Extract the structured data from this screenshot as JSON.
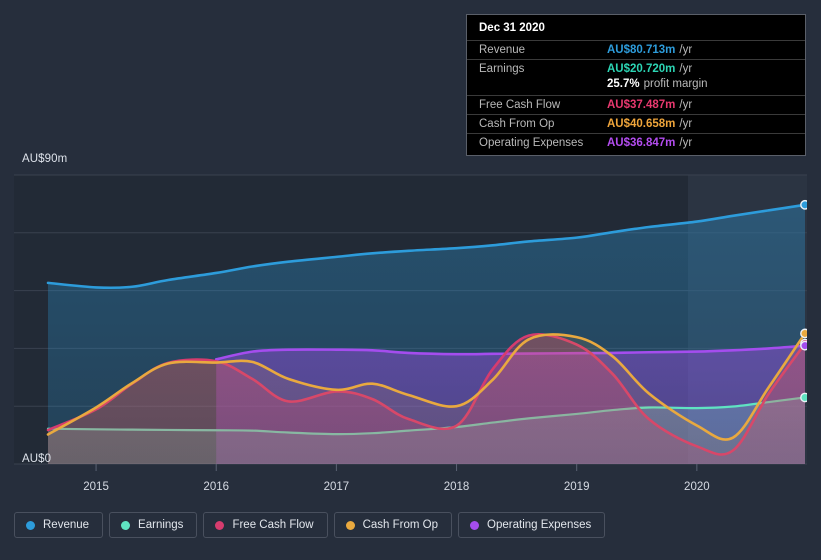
{
  "axis": {
    "y_max_label": "AU$90m",
    "y_min_label": "AU$0",
    "y_max_value": 90,
    "y_min_value": 0,
    "x_ticks": [
      "2015",
      "2016",
      "2017",
      "2018",
      "2019",
      "2020"
    ]
  },
  "tooltip": {
    "title": "Dec 31 2020",
    "rows": [
      {
        "label": "Revenue",
        "value": "AU$80.713m",
        "unit": "/yr",
        "color": "#2D9CDB"
      },
      {
        "label": "Earnings",
        "value": "AU$20.720m",
        "unit": "/yr",
        "color": "#2CD5B4"
      },
      {
        "label": "",
        "value": "25.7%",
        "unit": "profit margin",
        "color": "#FFFFFF"
      },
      {
        "label": "Free Cash Flow",
        "value": "AU$37.487m",
        "unit": "/yr",
        "color": "#E8396F"
      },
      {
        "label": "Cash From Op",
        "value": "AU$40.658m",
        "unit": "/yr",
        "color": "#EFA53B"
      },
      {
        "label": "Operating Expenses",
        "value": "AU$36.847m",
        "unit": "/yr",
        "color": "#B44DF0"
      }
    ]
  },
  "legend": {
    "items": [
      {
        "label": "Revenue",
        "color": "#2D9CDB"
      },
      {
        "label": "Earnings",
        "color": "#5FE3C2"
      },
      {
        "label": "Free Cash Flow",
        "color": "#D63C6E"
      },
      {
        "label": "Cash From Op",
        "color": "#E9A93F"
      },
      {
        "label": "Operating Expenses",
        "color": "#A44DEE"
      }
    ]
  },
  "colors": {
    "background": "#262E3C",
    "plot_background": "#222A36",
    "gridline": "#39414F",
    "forecast_band": "#2B3442"
  },
  "chart_data": {
    "type": "area",
    "title": "",
    "subtitle": "",
    "xlabel": "",
    "ylabel": "AU$",
    "ylim": [
      0,
      90
    ],
    "grid": true,
    "legend_position": "bottom",
    "x_tick_labels": [
      "2015",
      "2016",
      "2017",
      "2018",
      "2019",
      "2020"
    ],
    "x": [
      "2014.6",
      "2015.0",
      "2015.3",
      "2015.6",
      "2016.0",
      "2016.3",
      "2016.6",
      "2017.0",
      "2017.3",
      "2017.6",
      "2018.0",
      "2018.3",
      "2018.6",
      "2019.0",
      "2019.3",
      "2019.6",
      "2020.0",
      "2020.3",
      "2020.6",
      "2020.9"
    ],
    "series": [
      {
        "name": "Revenue",
        "color": "#2D9CDB",
        "values": [
          56.4,
          55.0,
          55.2,
          57.3,
          59.5,
          61.5,
          63.0,
          64.5,
          65.6,
          66.4,
          67.2,
          68.1,
          69.3,
          70.5,
          72.2,
          73.8,
          75.5,
          77.3,
          79.0,
          80.713
        ]
      },
      {
        "name": "Earnings",
        "color": "#5FE3C2",
        "values": [
          11.0,
          10.8,
          10.7,
          10.6,
          10.5,
          10.4,
          9.8,
          9.3,
          9.6,
          10.4,
          11.5,
          12.9,
          14.2,
          15.6,
          16.8,
          17.6,
          17.4,
          17.9,
          19.3,
          20.72
        ]
      },
      {
        "name": "Free Cash Flow",
        "color": "#D63C6E",
        "values": [
          10.6,
          17.0,
          25.0,
          31.5,
          32.0,
          26.5,
          19.5,
          22.6,
          20.2,
          14.0,
          11.9,
          29.5,
          40.0,
          37.2,
          28.0,
          14.0,
          5.5,
          4.2,
          22.0,
          37.487
        ]
      },
      {
        "name": "Cash From Op",
        "color": "#E9A93F",
        "values": [
          9.2,
          17.6,
          25.2,
          31.3,
          31.6,
          31.8,
          26.5,
          23.1,
          25.0,
          21.5,
          18.0,
          26.2,
          38.8,
          39.5,
          33.5,
          22.0,
          12.0,
          8.2,
          24.0,
          40.658
        ]
      },
      {
        "name": "Operating Expenses",
        "color": "#A44DEE",
        "values": [
          null,
          null,
          null,
          null,
          32.6,
          35.0,
          35.6,
          35.6,
          35.4,
          34.6,
          34.2,
          34.3,
          34.4,
          34.5,
          34.6,
          34.8,
          35.0,
          35.4,
          36.0,
          36.847
        ]
      }
    ],
    "end_markers": [
      {
        "name": "Revenue",
        "value": 80.713
      },
      {
        "name": "Cash From Op",
        "value": 40.658
      },
      {
        "name": "Free Cash Flow",
        "value": 37.487
      },
      {
        "name": "Operating Expenses",
        "value": 36.847
      },
      {
        "name": "Earnings",
        "value": 20.72
      }
    ]
  }
}
